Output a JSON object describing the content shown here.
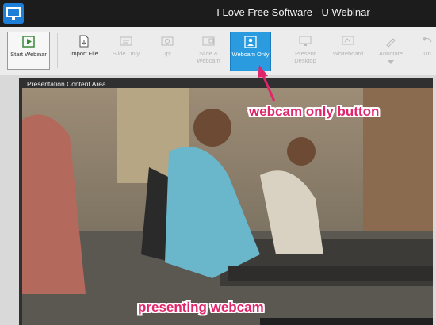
{
  "window": {
    "title": "I Love Free Software - U Webinar",
    "app_icon": "webinar-app-icon"
  },
  "ribbon": {
    "buttons": [
      {
        "label": "Start Webinar",
        "icon": "play-presentation-icon",
        "enabled": true
      },
      {
        "label": "Import File",
        "icon": "import-file-icon",
        "enabled": true
      },
      {
        "label": "Slide Only",
        "icon": "slide-only-icon",
        "enabled": false
      },
      {
        "label": "Jpt",
        "icon": "jpt-icon",
        "enabled": false
      },
      {
        "label": "Slide & Webcam",
        "icon": "slide-webcam-icon",
        "enabled": false
      },
      {
        "label": "Webcam Only",
        "icon": "webcam-icon",
        "enabled": true,
        "active": true
      },
      {
        "label": "Present Desktop",
        "icon": "desktop-icon",
        "enabled": false
      },
      {
        "label": "Whiteboard",
        "icon": "whiteboard-icon",
        "enabled": false
      },
      {
        "label": "Annotate",
        "icon": "annotate-icon",
        "enabled": false
      },
      {
        "label": "Un",
        "icon": "undo-icon",
        "enabled": false
      }
    ]
  },
  "content": {
    "label": "Presentation Content Area"
  },
  "annotations": {
    "webcam_button_note": "webcam only button",
    "presenting_note": "presenting webcam"
  },
  "colors": {
    "accent": "#2b9be0",
    "callout": "#e1256a",
    "titlebar": "#1c1c1c"
  }
}
